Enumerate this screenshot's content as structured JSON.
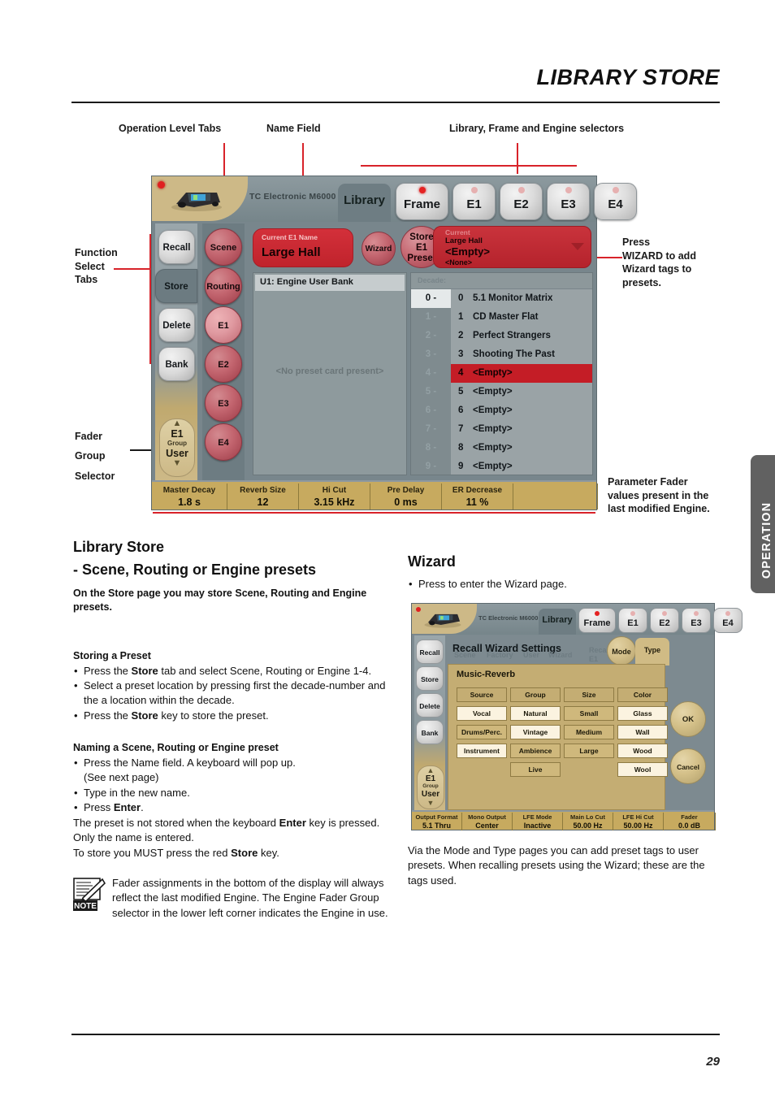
{
  "page": {
    "title": "LIBRARY STORE",
    "number": "29",
    "side_tab": "OPERATION"
  },
  "callouts": {
    "operation_level_tabs": "Operation Level Tabs",
    "name_field": "Name Field",
    "library_frame_engine": "Library, Frame and Engine selectors",
    "function_select_tabs": "Function\nSelect\nTabs",
    "fader_group_selector": "Fader\nGroup\nSelector",
    "press_wizard": "Press\nWIZARD to add\nWizard tags to\npresets.",
    "parameter_fader": "Parameter Fader\nvalues present in\nthe last modified\nEngine."
  },
  "device1": {
    "brand": "TC Electronic M6000",
    "level_tabs": [
      {
        "label": "Library",
        "type": "tab",
        "active": true
      },
      {
        "label": "Frame",
        "type": "knob",
        "led": true
      },
      {
        "label": "E1",
        "type": "knob",
        "led": false
      },
      {
        "label": "E2",
        "type": "knob",
        "led": false
      },
      {
        "label": "E3",
        "type": "knob",
        "led": false
      },
      {
        "label": "E4",
        "type": "knob",
        "led": false
      }
    ],
    "function_tabs": [
      {
        "label": "Recall",
        "selected": false
      },
      {
        "label": "Store",
        "selected": true
      },
      {
        "label": "Delete",
        "selected": false
      },
      {
        "label": "Bank",
        "selected": false
      }
    ],
    "fader_group_selector": {
      "engine": "E1",
      "group": "Group",
      "user": "User",
      "up": "▲",
      "down": "▼"
    },
    "selector_buttons": [
      {
        "label": "Scene",
        "lit": false
      },
      {
        "label": "Routing",
        "lit": false
      },
      {
        "label": "E1",
        "lit": true
      },
      {
        "label": "E2",
        "lit": false
      },
      {
        "label": "E3",
        "lit": false
      },
      {
        "label": "E4",
        "lit": false
      }
    ],
    "name_field": {
      "caption": "Current E1 Name",
      "value": "Large Hall"
    },
    "wizard_button": "Wizard",
    "store_button": {
      "line1": "Store",
      "line2": "E1",
      "line3": "Preset"
    },
    "current_field": {
      "caption": "Current",
      "current_name": "Large Hall",
      "target": "<Empty>",
      "target_sub": "<None>"
    },
    "bank_panel": {
      "title": "U1:   Engine User Bank",
      "message": "<No preset card present>"
    },
    "decade_header": "Decade:",
    "decades": [
      "0 -",
      "1 -",
      "2 -",
      "3 -",
      "4 -",
      "5 -",
      "6 -",
      "7 -",
      "8 -",
      "9 -"
    ],
    "selected_decade": 0,
    "presets": [
      {
        "num": "0",
        "name": "5.1 Monitor Matrix",
        "highlighted": false
      },
      {
        "num": "1",
        "name": "CD Master Flat",
        "highlighted": false
      },
      {
        "num": "2",
        "name": "Perfect Strangers",
        "highlighted": false
      },
      {
        "num": "3",
        "name": "Shooting The Past",
        "highlighted": false
      },
      {
        "num": "4",
        "name": "<Empty>",
        "highlighted": true
      },
      {
        "num": "5",
        "name": "<Empty>",
        "highlighted": false
      },
      {
        "num": "6",
        "name": "<Empty>",
        "highlighted": false
      },
      {
        "num": "7",
        "name": "<Empty>",
        "highlighted": false
      },
      {
        "num": "8",
        "name": "<Empty>",
        "highlighted": false
      },
      {
        "num": "9",
        "name": "<Empty>",
        "highlighted": false
      }
    ],
    "fader_bar": [
      {
        "label": "Master Decay",
        "value": "1.8 s"
      },
      {
        "label": "Reverb Size",
        "value": "12"
      },
      {
        "label": "Hi Cut",
        "value": "3.15 kHz"
      },
      {
        "label": "Pre Delay",
        "value": "0 ms"
      },
      {
        "label": "ER Decrease",
        "value": "11 %"
      },
      {
        "label": "",
        "value": ""
      }
    ]
  },
  "device2": {
    "brand": "TC Electronic M6000",
    "level_tabs": [
      {
        "label": "Library",
        "type": "tab",
        "active": true
      },
      {
        "label": "Frame",
        "type": "knob",
        "led": true
      },
      {
        "label": "E1",
        "type": "knob",
        "led": false
      },
      {
        "label": "E2",
        "type": "knob",
        "led": false
      },
      {
        "label": "E3",
        "type": "knob",
        "led": false
      },
      {
        "label": "E4",
        "type": "knob",
        "led": false
      }
    ],
    "function_tabs": [
      {
        "label": "Recall",
        "selected": false
      },
      {
        "label": "Store",
        "selected": false
      },
      {
        "label": "Delete",
        "selected": false
      },
      {
        "label": "Bank",
        "selected": false
      }
    ],
    "fader_group_selector": {
      "engine": "E1",
      "group": "Group",
      "user": "User",
      "up": "▲",
      "down": "▼"
    },
    "wizard_heading": "Recall Wizard Settings",
    "ghost_labels": [
      "Scene",
      "Factory",
      "User",
      "Wizard",
      "Recall\nE1\nPreset"
    ],
    "mode_button": "Mode",
    "type_tab": "Type",
    "panel_title": "Music-Reverb",
    "tag_columns": [
      {
        "header": "Source",
        "options": [
          {
            "label": "Vocal",
            "on": false
          },
          {
            "label": "Drums/Perc.",
            "on": true
          },
          {
            "label": "Instrument",
            "on": false
          }
        ]
      },
      {
        "header": "Group",
        "options": [
          {
            "label": "Natural",
            "on": false
          },
          {
            "label": "Vintage",
            "on": false
          },
          {
            "label": "Ambience",
            "on": true
          },
          {
            "label": "Live",
            "on": true
          }
        ]
      },
      {
        "header": "Size",
        "options": [
          {
            "label": "Small",
            "on": true
          },
          {
            "label": "Medium",
            "on": true
          },
          {
            "label": "Large",
            "on": true
          }
        ]
      },
      {
        "header": "Color",
        "options": [
          {
            "label": "Glass",
            "on": false
          },
          {
            "label": "Wall",
            "on": false
          },
          {
            "label": "Wood",
            "on": false
          },
          {
            "label": "Wool",
            "on": false
          }
        ]
      }
    ],
    "ok_button": "OK",
    "cancel_button": "Cancel",
    "fader_bar": [
      {
        "label": "Output Format",
        "value": "5.1 Thru"
      },
      {
        "label": "Mono Output",
        "value": "Center"
      },
      {
        "label": "LFE Mode",
        "value": "Inactive"
      },
      {
        "label": "Main Lo Cut",
        "value": "50.00 Hz"
      },
      {
        "label": "LFE Hi Cut",
        "value": "50.00 Hz"
      },
      {
        "label": "Fader",
        "value": "0.0 dB"
      }
    ]
  },
  "left_column": {
    "heading_line1": "Library Store",
    "heading_line2": "- Scene, Routing or Engine presets",
    "intro": "On the Store page you may store Scene, Routing and Engine presets.",
    "storing_heading": "Storing a Preset",
    "storing_bullets": [
      "Press the Store tab and select Scene, Routing or Engine 1-4.",
      "Select a preset location by pressing first the decade-number and the a location within the decade.",
      "Press the Store key to store the preset."
    ],
    "naming_heading": "Naming a Scene, Routing or Engine preset",
    "naming_bullets": [
      "Press the Name field. A keyboard will pop up. (See next page)",
      "Type in the new name.",
      "Press Enter."
    ],
    "naming_para1": "The preset is not stored when the keyboard Enter key is pressed. Only the name is entered.",
    "naming_para2": "To store you MUST press the red Store key.",
    "note": "Fader assignments in the bottom of the display will always reflect the last modified Engine. The Engine Fader Group selector in the lower left corner indicates the Engine in use.",
    "note_badge": "NOTE"
  },
  "right_column": {
    "heading": "Wizard",
    "bullet": "Press to enter the Wizard page.",
    "para": "Via the Mode and Type pages you can add preset tags to user presets. When recalling presets using the Wizard; these are the tags used."
  },
  "colors": {
    "accent_red": "#d8232a",
    "device_bg": "#7d8c91",
    "fader_gold": "#c7aa5f",
    "side_tab": "#616161"
  }
}
